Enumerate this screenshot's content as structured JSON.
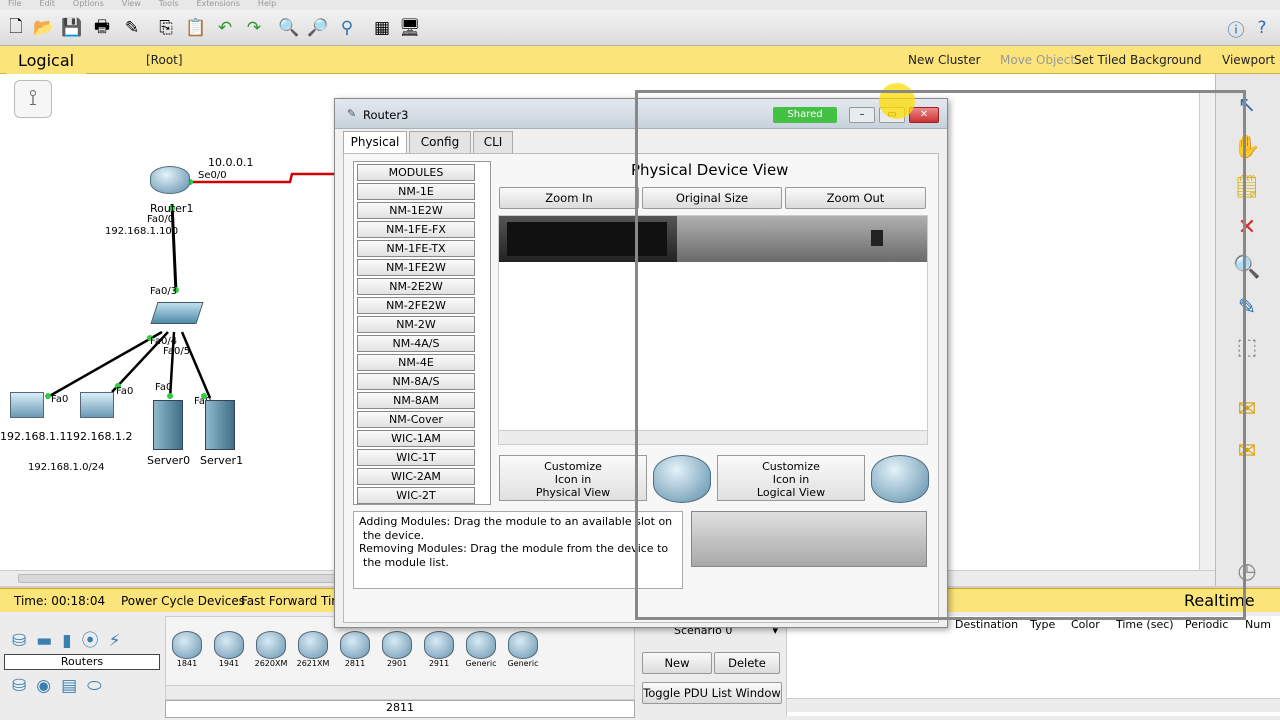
{
  "menubar": [
    "File",
    "Edit",
    "Options",
    "View",
    "Tools",
    "Extensions",
    "Help"
  ],
  "toolbar_icons": [
    "new-file-icon",
    "open-folder-icon",
    "save-icon",
    "print-icon",
    "activity-wizard-icon",
    "copy-icon",
    "paste-icon",
    "undo-icon",
    "redo-icon",
    "zoom-in-icon",
    "zoom-reset-icon",
    "zoom-out-icon",
    "palette-icon",
    "custom-device-icon"
  ],
  "logicalbar": {
    "tab": "Logical",
    "root": "[Root]",
    "new_cluster": "New Cluster",
    "move_object": "Move Object",
    "set_tiled_bg": "Set Tiled Background",
    "viewport": "Viewport"
  },
  "topology": {
    "router1": "Router1",
    "router1_ip": "10.0.0.1",
    "router1_serial": "Se0/0",
    "router1_fa": "Fa0/0",
    "router1_lan_ip": "192.168.1.100",
    "switch_fa3": "Fa0/3",
    "switch_fa4": "Fa0/4",
    "switch_fa5": "Fa0/5",
    "pc0_port": "Fa0",
    "pc0_ip": "192.168.1.1",
    "pc1_port": "Fa0",
    "pc1_ip": "192.168.1.2",
    "server0": "Server0",
    "server0_port": "Fa0",
    "server1": "Server1",
    "server1_port": "Fa0",
    "network": "192.168.1.0/24"
  },
  "window": {
    "title": "Router3",
    "shared": "Shared",
    "tabs": [
      "Physical",
      "Config",
      "CLI"
    ],
    "modules": [
      "MODULES",
      "NM-1E",
      "NM-1E2W",
      "NM-1FE-FX",
      "NM-1FE-TX",
      "NM-1FE2W",
      "NM-2E2W",
      "NM-2FE2W",
      "NM-2W",
      "NM-4A/S",
      "NM-4E",
      "NM-8A/S",
      "NM-8AM",
      "NM-Cover",
      "WIC-1AM",
      "WIC-1T",
      "WIC-2AM",
      "WIC-2T"
    ],
    "view_title": "Physical Device View",
    "zoom_in": "Zoom In",
    "original_size": "Original Size",
    "zoom_out": "Zoom Out",
    "customize_physical": [
      "Customize",
      "Icon in",
      "Physical View"
    ],
    "customize_logical": [
      "Customize",
      "Icon in",
      "Logical View"
    ],
    "help_lines": [
      "Adding Modules: Drag the module to an available slot on",
      "the device.",
      "Removing Modules: Drag the module from the device to",
      "the module list."
    ]
  },
  "status": {
    "time": "Time: 00:18:04",
    "power_cycle": "Power Cycle Devices",
    "fast_forward": "Fast Forward Time",
    "realtime": "Realtime"
  },
  "bottom": {
    "category": "Routers",
    "devices": [
      "1841",
      "1941",
      "2620XM",
      "2621XM",
      "2811",
      "2901",
      "2911",
      "Generic",
      "Generic"
    ],
    "selected_device": "2811",
    "scenario": "Scenario 0",
    "new": "New",
    "delete": "Delete",
    "toggle_pdu": "Toggle PDU List Window",
    "pdu_columns": [
      "Destination",
      "Type",
      "Color",
      "Time (sec)",
      "Periodic",
      "Num"
    ]
  },
  "colors": {
    "status_yellow": "#fbe47a",
    "shared_green": "#44c144",
    "link_red": "#d00000"
  }
}
